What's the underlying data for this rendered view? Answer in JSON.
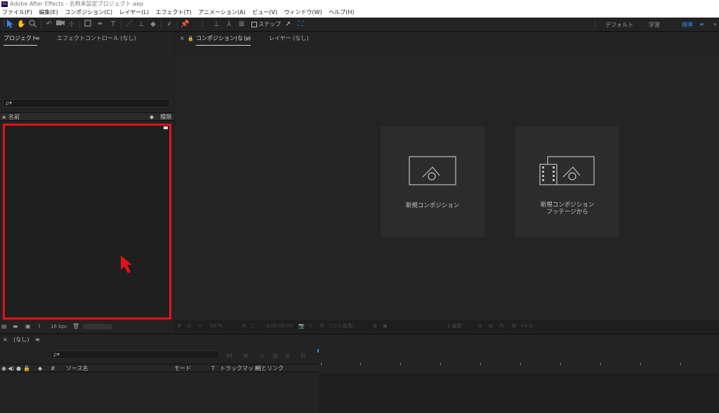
{
  "titlebar": {
    "app_icon": "Ae",
    "title": "Adobe After Effects - 名称未設定プロジェクト.aep"
  },
  "menu": [
    "ファイル(F)",
    "編集(E)",
    "コンポジション(C)",
    "レイヤー(L)",
    "エフェクト(T)",
    "アニメーション(A)",
    "ビュー(V)",
    "ウィンドウ(W)",
    "ヘルプ(H)"
  ],
  "toolbar": {
    "snap_label": "スナップ",
    "workspaces": [
      "デフォルト",
      "学習",
      "標準"
    ],
    "active_workspace": "標準",
    "menu_glyph": "≡",
    "accent": "#2d8ceb"
  },
  "project_panel": {
    "tabs": [
      "プロジェクト",
      "エフェクトコントロール (なし)"
    ],
    "menu_glyph": "≡",
    "search_glyph": "ρ▾",
    "col_name": "名前",
    "col_type": "種類",
    "bpc": "16 bpc",
    "highlight_color": "#e0131a"
  },
  "comp_panel": {
    "tabs": [
      "コンポジション(なし)",
      "レイヤー (なし)"
    ],
    "menu_glyph": "≡",
    "close_glyph": "×",
    "lock_glyph": "🔒",
    "cards": [
      {
        "line1": "新規コンポジション",
        "line2": ""
      },
      {
        "line1": "新規コンポジション",
        "line2": "フッテージから"
      }
    ],
    "footer": {
      "zoom": "50 %",
      "time": "0;00;00;00",
      "resolution": "(フル画質)",
      "view": "1 画面",
      "offset": "+0.0"
    }
  },
  "timeline": {
    "tab_label": "(なし)",
    "close_glyph": "×",
    "menu_glyph": "≡",
    "search_glyph": "ρ▾",
    "columns": [
      "#",
      "ソース名",
      "モード",
      "T",
      "トラックマット",
      "親とリンク"
    ]
  }
}
